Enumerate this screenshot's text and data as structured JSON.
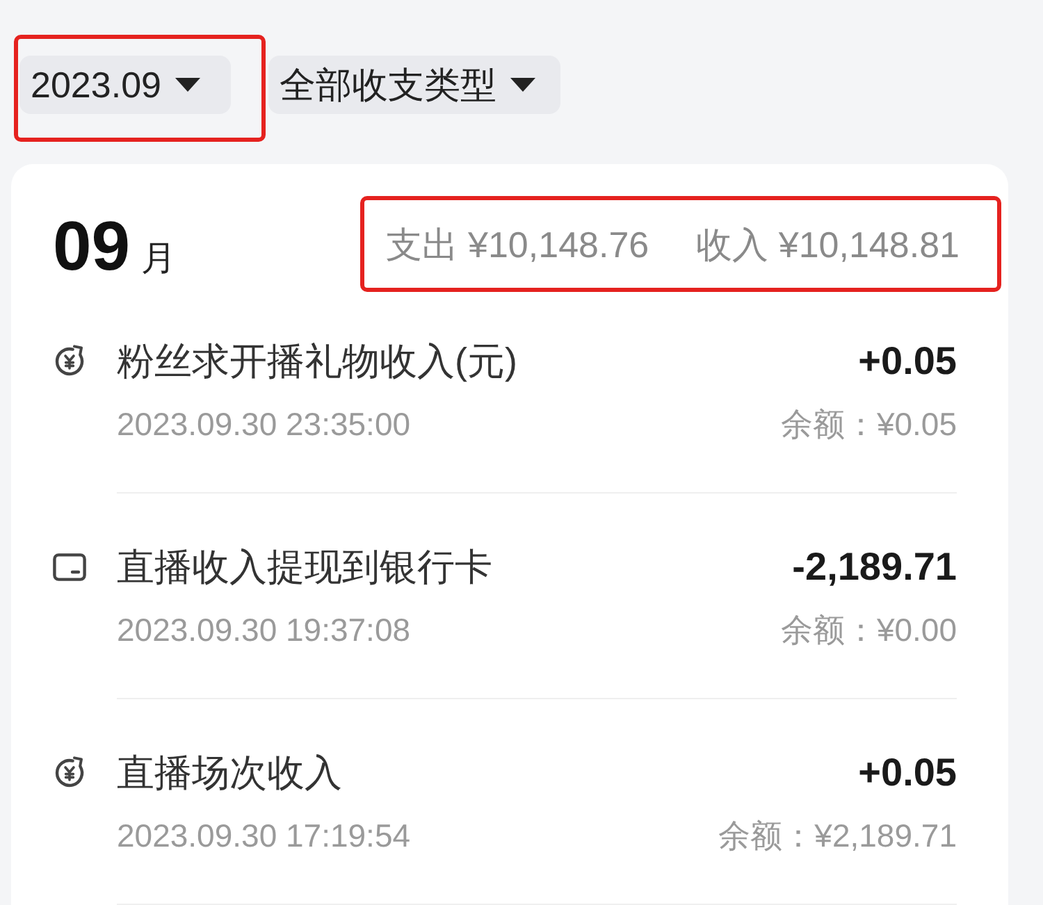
{
  "filters": [
    {
      "label": "2023.09",
      "highlighted": true
    },
    {
      "label": "全部收支类型",
      "highlighted": false
    }
  ],
  "month": {
    "number": "09",
    "unit": "月"
  },
  "summary": {
    "items": [
      "支出 ¥10,148.76",
      "收入 ¥10,148.81"
    ],
    "highlighted": true
  },
  "transactions": [
    {
      "kind": "income",
      "title": "粉丝求开播礼物收入(元)",
      "time": "2023.09.30 23:35:00",
      "amount": "+0.05",
      "balance": "余额：¥0.05"
    },
    {
      "kind": "withdrawal",
      "title": "直播收入提现到银行卡",
      "time": "2023.09.30 19:37:08",
      "amount": "-2,189.71",
      "balance": "余额：¥0.00"
    },
    {
      "kind": "income",
      "title": "直播场次收入",
      "time": "2023.09.30 17:19:54",
      "amount": "+0.05",
      "balance": "余额：¥2,189.71"
    }
  ]
}
